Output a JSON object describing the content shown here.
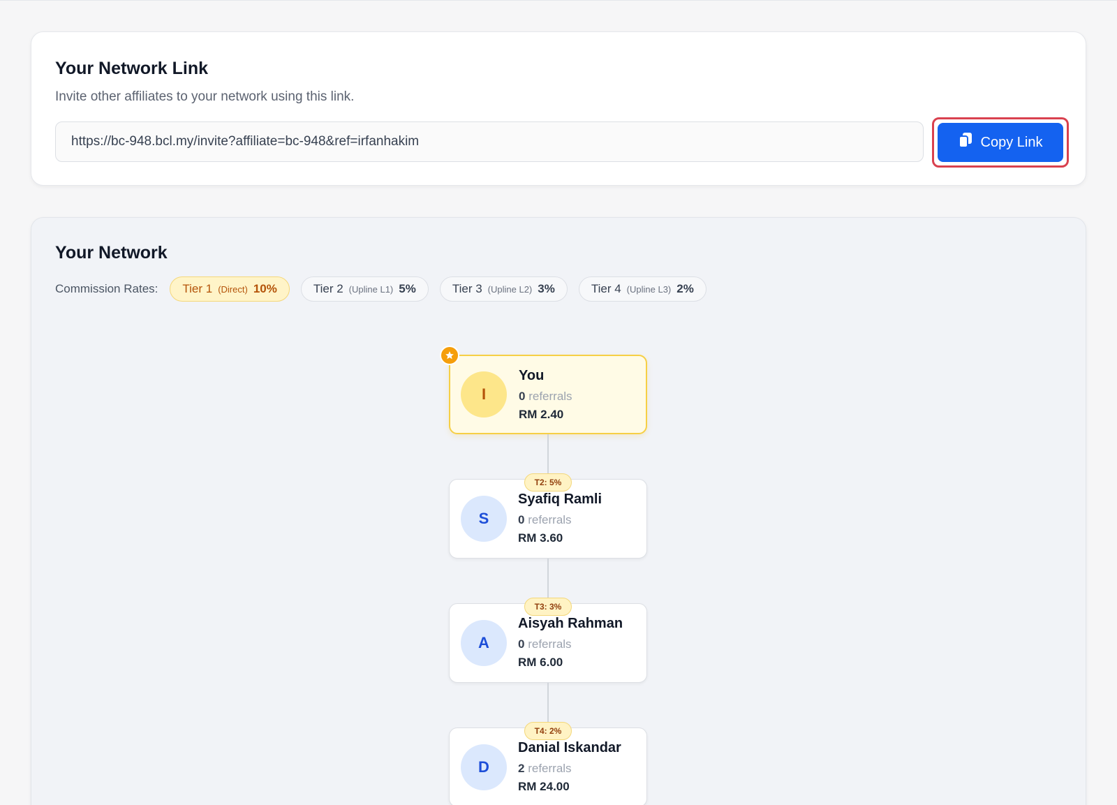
{
  "link_card": {
    "title": "Your Network Link",
    "description": "Invite other affiliates to your network using this link.",
    "invite_url": "https://bc-948.bcl.my/invite?affiliate=bc-948&ref=irfanhakim",
    "copy_button_label": "Copy Link",
    "copy_icon": "copy-icon"
  },
  "network_card": {
    "title": "Your Network",
    "commission_label": "Commission Rates:",
    "tiers": [
      {
        "name": "Tier 1",
        "sub": "(Direct)",
        "pct": "10%",
        "active": true
      },
      {
        "name": "Tier 2",
        "sub": "(Upline L1)",
        "pct": "5%",
        "active": false
      },
      {
        "name": "Tier 3",
        "sub": "(Upline L2)",
        "pct": "3%",
        "active": false
      },
      {
        "name": "Tier 4",
        "sub": "(Upline L3)",
        "pct": "2%",
        "active": false
      }
    ],
    "nodes": [
      {
        "initial": "I",
        "name": "You",
        "ref_count": "0",
        "ref_label": "referrals",
        "amount": "RM 2.40",
        "badge": "",
        "is_self": true
      },
      {
        "initial": "S",
        "name": "Syafiq Ramli",
        "ref_count": "0",
        "ref_label": "referrals",
        "amount": "RM 3.60",
        "badge": "T2: 5%",
        "is_self": false
      },
      {
        "initial": "A",
        "name": "Aisyah Rahman",
        "ref_count": "0",
        "ref_label": "referrals",
        "amount": "RM 6.00",
        "badge": "T3: 3%",
        "is_self": false
      },
      {
        "initial": "D",
        "name": "Danial Iskandar",
        "ref_count": "2",
        "ref_label": "referrals",
        "amount": "RM 24.00",
        "badge": "T4: 2%",
        "is_self": false
      }
    ]
  },
  "colors": {
    "primary": "#1462f0",
    "highlight_outline": "#d9414f",
    "tier_active_bg": "#fff4c8",
    "tier_active_text": "#b45309",
    "self_node_border": "#f6cf45",
    "avatar_bg": "#dbe8fd",
    "avatar_text": "#1d4ed8"
  }
}
